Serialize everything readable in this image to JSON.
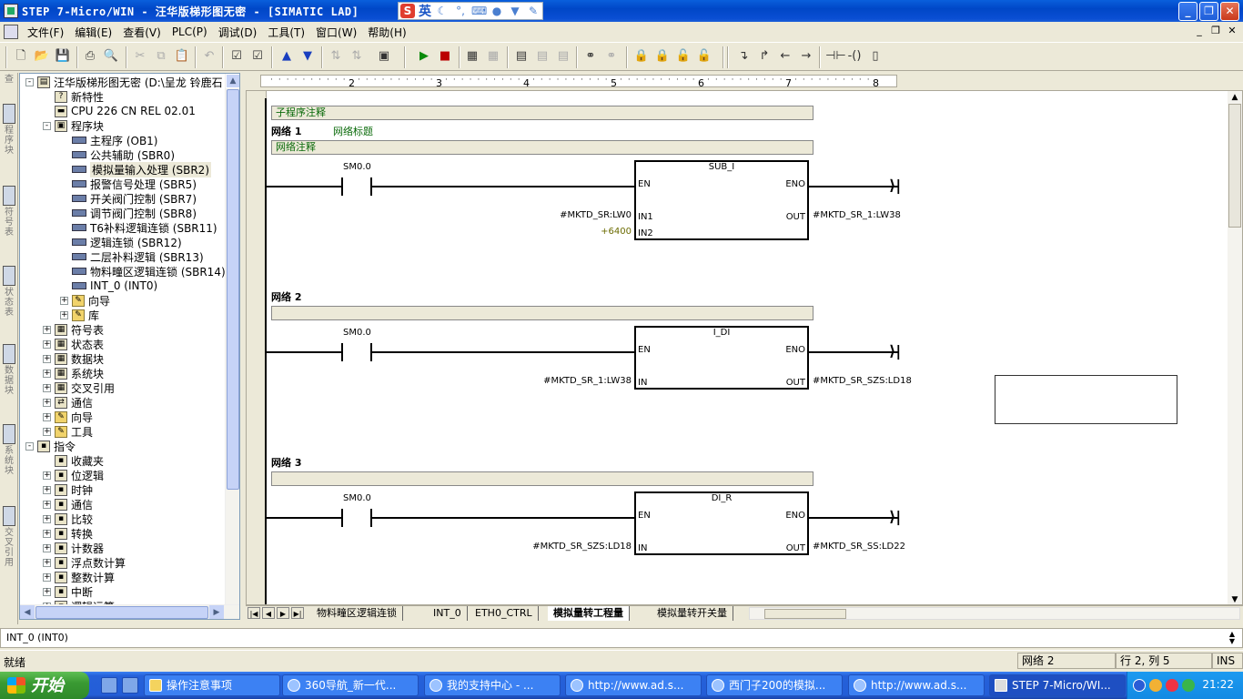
{
  "window": {
    "title": "STEP 7-Micro/WIN - 汪华版梯形图无密 - [SIMATIC LAD]",
    "ime_lang": "英"
  },
  "menu": [
    "文件(F)",
    "编辑(E)",
    "查看(V)",
    "PLC(P)",
    "调试(D)",
    "工具(T)",
    "窗口(W)",
    "帮助(H)"
  ],
  "navbar": [
    {
      "label": "程序块"
    },
    {
      "label": "符号表"
    },
    {
      "label": "状态表"
    },
    {
      "label": "数据块"
    },
    {
      "label": "系统块"
    },
    {
      "label": "交叉引用"
    }
  ],
  "tree": {
    "items": [
      {
        "label": "汪华版梯形图无密 (D:\\呈龙 铃鹿石",
        "level": 0,
        "exp": "-",
        "icon": "project"
      },
      {
        "label": "新特性",
        "level": 1,
        "exp": "",
        "icon": "help"
      },
      {
        "label": "CPU 226 CN REL 02.01",
        "level": 1,
        "exp": "",
        "icon": "cpu"
      },
      {
        "label": "程序块",
        "level": 1,
        "exp": "-",
        "icon": "prog"
      },
      {
        "label": "主程序 (OB1)",
        "level": 2,
        "exp": "",
        "icon": "block"
      },
      {
        "label": "公共辅助 (SBR0)",
        "level": 2,
        "exp": "",
        "icon": "block"
      },
      {
        "label": "模拟量输入处理 (SBR2)",
        "level": 2,
        "exp": "",
        "icon": "block",
        "selected": true
      },
      {
        "label": "报警信号处理 (SBR5)",
        "level": 2,
        "exp": "",
        "icon": "block"
      },
      {
        "label": "开关阀门控制 (SBR7)",
        "level": 2,
        "exp": "",
        "icon": "block"
      },
      {
        "label": "调节阀门控制 (SBR8)",
        "level": 2,
        "exp": "",
        "icon": "block"
      },
      {
        "label": "T6补料逻辑连锁 (SBR11)",
        "level": 2,
        "exp": "",
        "icon": "block"
      },
      {
        "label": "逻辑连锁 (SBR12)",
        "level": 2,
        "exp": "",
        "icon": "block"
      },
      {
        "label": "二层补料逻辑 (SBR13)",
        "level": 2,
        "exp": "",
        "icon": "block"
      },
      {
        "label": "物料疃区逻辑连锁 (SBR14)",
        "level": 2,
        "exp": "",
        "icon": "block"
      },
      {
        "label": "INT_0 (INT0)",
        "level": 2,
        "exp": "",
        "icon": "block"
      },
      {
        "label": "向导",
        "level": 2,
        "exp": "+",
        "icon": "folder"
      },
      {
        "label": "库",
        "level": 2,
        "exp": "+",
        "icon": "folder"
      },
      {
        "label": "符号表",
        "level": 1,
        "exp": "+",
        "icon": "table"
      },
      {
        "label": "状态表",
        "level": 1,
        "exp": "+",
        "icon": "table"
      },
      {
        "label": "数据块",
        "level": 1,
        "exp": "+",
        "icon": "table"
      },
      {
        "label": "系统块",
        "level": 1,
        "exp": "+",
        "icon": "table"
      },
      {
        "label": "交叉引用",
        "level": 1,
        "exp": "+",
        "icon": "table"
      },
      {
        "label": "通信",
        "level": 1,
        "exp": "+",
        "icon": "comm"
      },
      {
        "label": "向导",
        "level": 1,
        "exp": "+",
        "icon": "folder"
      },
      {
        "label": "工具",
        "level": 1,
        "exp": "+",
        "icon": "folder"
      },
      {
        "label": "指令",
        "level": 0,
        "exp": "-",
        "icon": "instr"
      },
      {
        "label": "收藏夹",
        "level": 1,
        "exp": "",
        "icon": "instr"
      },
      {
        "label": "位逻辑",
        "level": 1,
        "exp": "+",
        "icon": "instr"
      },
      {
        "label": "时钟",
        "level": 1,
        "exp": "+",
        "icon": "instr"
      },
      {
        "label": "通信",
        "level": 1,
        "exp": "+",
        "icon": "instr"
      },
      {
        "label": "比较",
        "level": 1,
        "exp": "+",
        "icon": "instr"
      },
      {
        "label": "转换",
        "level": 1,
        "exp": "+",
        "icon": "instr"
      },
      {
        "label": "计数器",
        "level": 1,
        "exp": "+",
        "icon": "instr"
      },
      {
        "label": "浮点数计算",
        "level": 1,
        "exp": "+",
        "icon": "instr"
      },
      {
        "label": "整数计算",
        "level": 1,
        "exp": "+",
        "icon": "instr"
      },
      {
        "label": "中断",
        "level": 1,
        "exp": "+",
        "icon": "instr"
      },
      {
        "label": "逻辑运算",
        "level": 1,
        "exp": "+",
        "icon": "instr"
      }
    ]
  },
  "ruler": [
    "2",
    "3",
    "4",
    "5",
    "6",
    "7",
    "8"
  ],
  "editor": {
    "subroutine_comment": "子程序注释",
    "networks": [
      {
        "label": "网络 1",
        "title": "网络标题",
        "comment": "网络注释",
        "contact": "SM0.0",
        "block": "SUB_I",
        "pins_left": [
          "EN",
          "IN1",
          "IN2"
        ],
        "pins_right": [
          "ENO",
          "OUT"
        ],
        "inputs": [
          "#MKTD_SR:LW0",
          "+6400"
        ],
        "outputs": [
          "#MKTD_SR_1:LW38"
        ]
      },
      {
        "label": "网络 2",
        "title": "",
        "comment": "",
        "contact": "SM0.0",
        "block": "I_DI",
        "pins_left": [
          "EN",
          "IN"
        ],
        "pins_right": [
          "ENO",
          "OUT"
        ],
        "inputs": [
          "#MKTD_SR_1:LW38"
        ],
        "outputs": [
          "#MKTD_SR_SZS:LD18"
        ]
      },
      {
        "label": "网络 3",
        "title": "",
        "comment": "",
        "contact": "SM0.0",
        "block": "DI_R",
        "pins_left": [
          "EN",
          "IN"
        ],
        "pins_right": [
          "ENO",
          "OUT"
        ],
        "inputs": [
          "#MKTD_SR_SZS:LD18"
        ],
        "outputs": [
          "#MKTD_SR_SS:LD22"
        ]
      }
    ]
  },
  "tabs": [
    {
      "label": "物料疃区逻辑连锁",
      "active": false
    },
    {
      "label": "INT_0",
      "active": false
    },
    {
      "label": "ETH0_CTRL",
      "active": false
    },
    {
      "label": "模拟量转工程量",
      "active": true
    },
    {
      "label": "模拟量转开关量",
      "active": false
    }
  ],
  "output": {
    "text": "INT_0 (INT0)"
  },
  "status": {
    "text": "就绪",
    "network": "网络 2",
    "position": "行 2, 列 5",
    "mode": "INS"
  },
  "taskbar": {
    "start": "开始",
    "tasks": [
      {
        "label": "操作注意事项",
        "icon": "folder"
      },
      {
        "label": "360导航_新一代...",
        "icon": "ie"
      },
      {
        "label": "我的支持中心 - ...",
        "icon": "ie"
      },
      {
        "label": "http://www.ad.s...",
        "icon": "ie"
      },
      {
        "label": "西门子200的模拟...",
        "icon": "ie"
      },
      {
        "label": "http://www.ad.s...",
        "icon": "ie"
      },
      {
        "label": "STEP 7-Micro/WI...",
        "icon": "app",
        "active": true
      }
    ],
    "clock": "21:22"
  }
}
